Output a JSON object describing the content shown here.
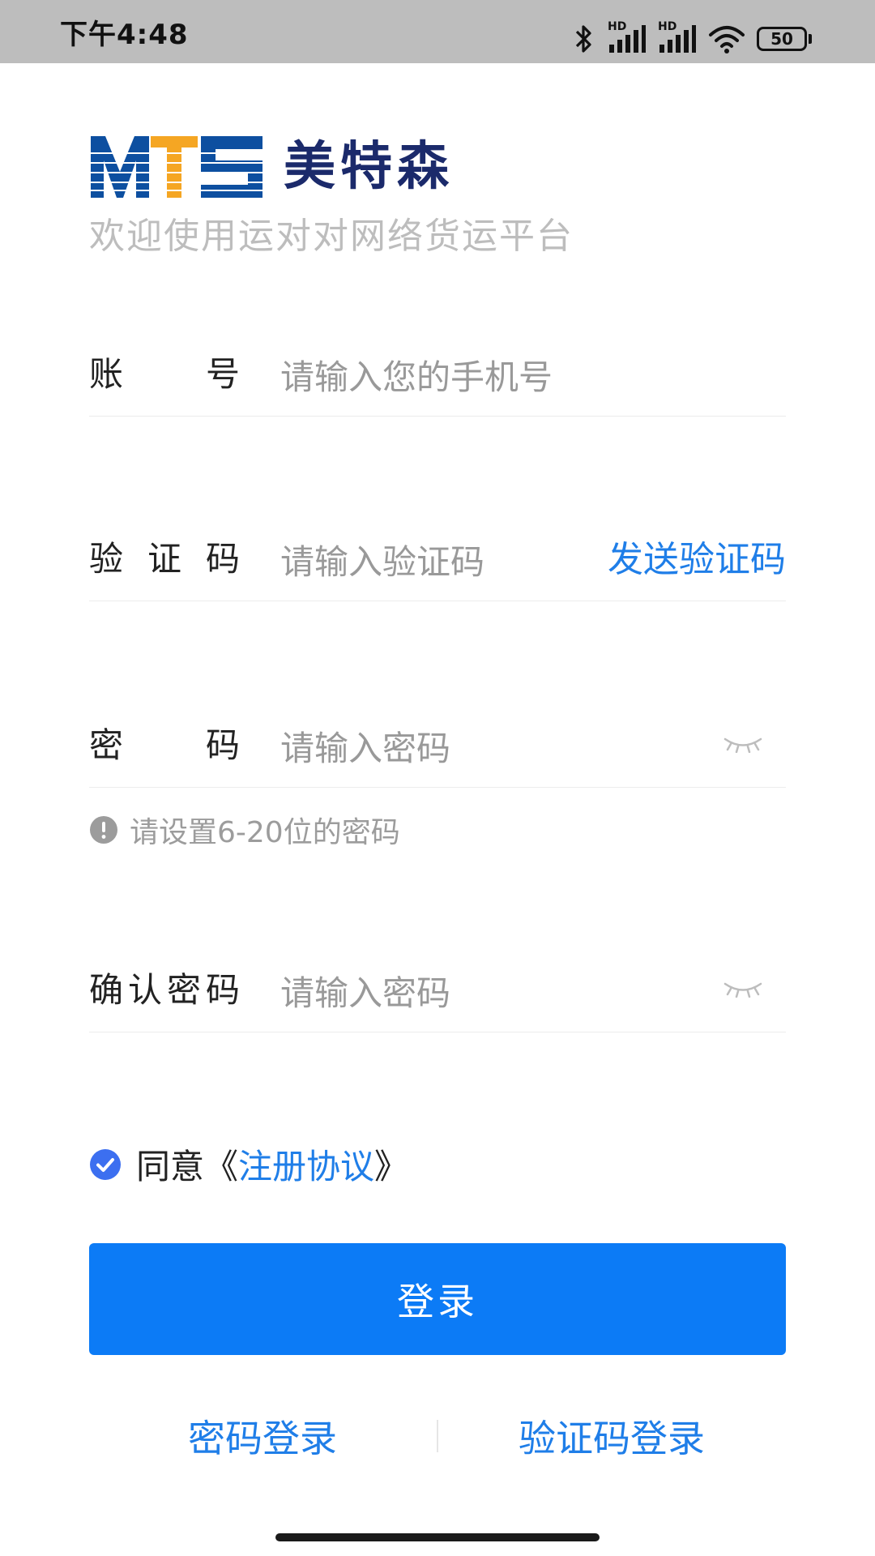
{
  "status_bar": {
    "time": "下午4:48",
    "battery": "50",
    "signal_1_label": "HD",
    "signal_2_label": "HD"
  },
  "brand": {
    "logo_text": "MTS",
    "name": "美特森",
    "welcome": "欢迎使用运对对网络货运平台",
    "colors": {
      "primary": "#0d4fa0",
      "accent": "#f5a623",
      "name": "#1b2a6b"
    }
  },
  "form": {
    "account": {
      "label": "账号",
      "placeholder": "请输入您的手机号"
    },
    "code": {
      "label": "验证码",
      "placeholder": "请输入验证码",
      "send_label": "发送验证码"
    },
    "password": {
      "label": "密码",
      "placeholder": "请输入密码",
      "hint": "请设置6-20位的密码"
    },
    "confirm": {
      "label": "确认密码",
      "placeholder": "请输入密码"
    }
  },
  "agreement": {
    "checked": true,
    "prefix": "同意《",
    "link": "注册协议",
    "suffix": "》"
  },
  "login_button": {
    "label": "登录",
    "color": "#0c7bf6"
  },
  "alt_login": {
    "password_login": "密码登录",
    "code_login": "验证码登录"
  },
  "icons": {
    "status": [
      "bluetooth-icon",
      "signal-icon",
      "signal-icon",
      "wifi-icon",
      "battery-icon"
    ],
    "password_toggle": "eye-closed-icon",
    "hint": "exclamation-circle-icon",
    "agree": "check-circle-icon"
  }
}
